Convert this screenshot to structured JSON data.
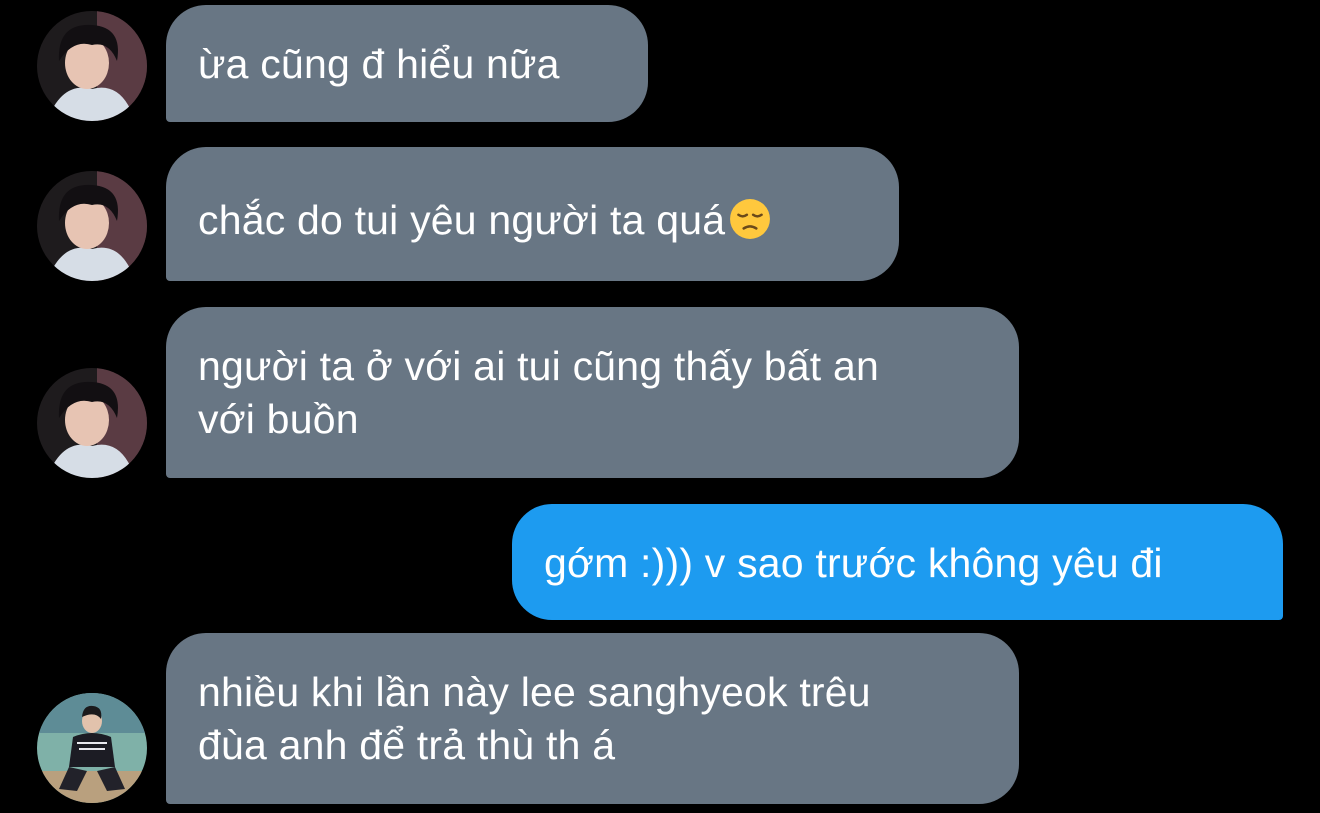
{
  "messages": [
    {
      "direction": "incoming",
      "avatar": "avatar-dark-portrait",
      "lines": [
        "ừa cũng đ hiểu nữa"
      ]
    },
    {
      "direction": "incoming",
      "avatar": "avatar-dark-portrait",
      "lines": [
        "chắc do tui yêu người ta quá"
      ],
      "emoji": "pensive-face-icon"
    },
    {
      "direction": "incoming",
      "avatar": "avatar-dark-portrait",
      "lines": [
        "người ta ở với ai tui cũng thấy bất an",
        "với buồn"
      ]
    },
    {
      "direction": "outgoing",
      "lines": [
        "gớm :))) v sao trước không yêu đi"
      ]
    },
    {
      "direction": "incoming",
      "avatar": "avatar-court-photo",
      "lines": [
        "nhiều khi lần này lee sanghyeok trêu",
        "đùa anh để trả thù th á"
      ]
    }
  ],
  "colors": {
    "background": "#000000",
    "incoming_bubble": "#687684",
    "outgoing_bubble": "#1d9bf0",
    "text": "#ffffff"
  }
}
